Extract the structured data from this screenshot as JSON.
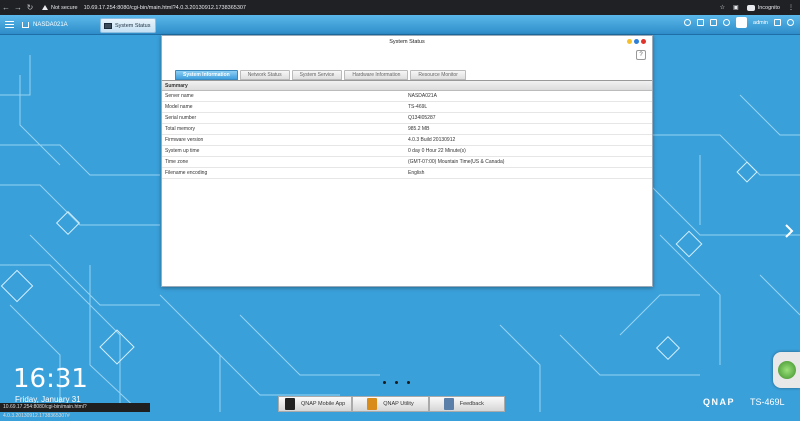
{
  "browser": {
    "insecure_label": "Not secure",
    "url": "10.69.17.254:8080/cgi-bin/main.html?4.0.3.20130912.1738365307",
    "profile_label": "Incognito"
  },
  "qnap_bar": {
    "host_name": "NASDA021A",
    "active_tab": "System Status",
    "user_name": "admin"
  },
  "window": {
    "title": "System Status",
    "help": "?",
    "tabs": [
      {
        "label": "System Information",
        "active": true
      },
      {
        "label": "Network Status",
        "active": false
      },
      {
        "label": "System Service",
        "active": false
      },
      {
        "label": "Hardware Information",
        "active": false
      },
      {
        "label": "Resource Monitor",
        "active": false
      }
    ],
    "section_header": "Summary",
    "rows": [
      {
        "key": "Server name",
        "value": "NASDA021A"
      },
      {
        "key": "Model name",
        "value": "TS-469L"
      },
      {
        "key": "Serial number",
        "value": "Q134I05287"
      },
      {
        "key": "Total memory",
        "value": "985.2 MB"
      },
      {
        "key": "Firmware version",
        "value": "4.0.3 Build 20130912"
      },
      {
        "key": "System up time",
        "value": "0 day 0 Hour 22 Minute(s)"
      },
      {
        "key": "Time zone",
        "value": "(GMT-07:00) Mountain Time(US & Canada)"
      },
      {
        "key": "Filename encoding",
        "value": "English"
      }
    ]
  },
  "desktop": {
    "clock": "16:31",
    "date": "Friday, January 31"
  },
  "dock": [
    {
      "label": "QNAP Mobile App",
      "icon": "phone-icon",
      "color": "#222222"
    },
    {
      "label": "QNAP Utility",
      "icon": "toolbox-icon",
      "color": "#d98c1a"
    },
    {
      "label": "Feedback",
      "icon": "pencil-icon",
      "color": "#5a7fa8"
    }
  ],
  "status_url": "10.69.17.254:8080/cgi-bin/main.html?4.0.3.20130912.1738365307#",
  "brand": {
    "logo": "QNAP",
    "model": "TS-469L"
  },
  "colors": {
    "desktop_bg": "#3aa0da",
    "active_tab": "#3f9fdc"
  }
}
